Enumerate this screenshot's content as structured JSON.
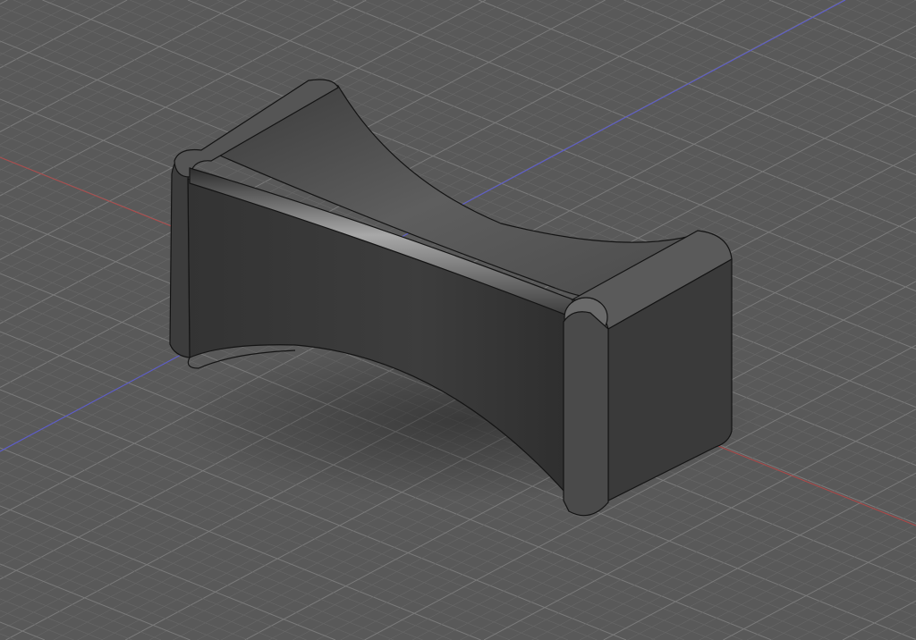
{
  "viewport": {
    "background": "#595959",
    "grid_major": "#7a7a7a",
    "grid_minor": "#666666",
    "x_axis_color": "#b04848",
    "y_axis_color": "#5a5ad0"
  },
  "model": {
    "body_color": "#4a4a4a",
    "edge_color": "#141414",
    "highlight_color": "#9a9a9a"
  }
}
